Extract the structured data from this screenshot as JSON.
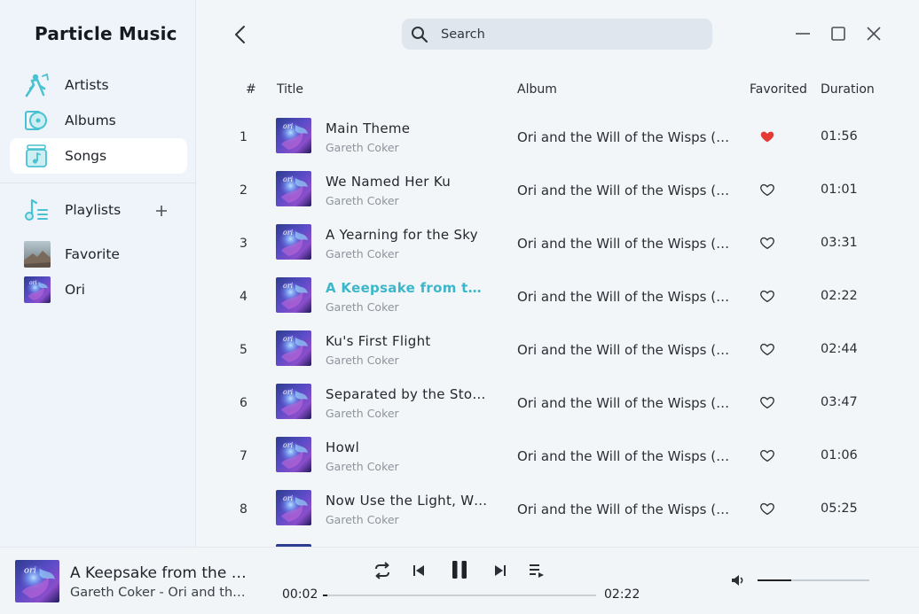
{
  "app": {
    "title": "Particle Music"
  },
  "sidebar": {
    "nav": [
      {
        "label": "Artists",
        "icon": "artist-icon"
      },
      {
        "label": "Albums",
        "icon": "album-icon"
      },
      {
        "label": "Songs",
        "icon": "songs-icon",
        "active": true
      }
    ],
    "playlists_label": "Playlists",
    "playlists": [
      {
        "label": "Favorite"
      },
      {
        "label": "Ori"
      }
    ]
  },
  "search": {
    "placeholder": "Search"
  },
  "table": {
    "headers": {
      "num": "#",
      "title": "Title",
      "album": "Album",
      "favorited": "Favorited",
      "duration": "Duration"
    },
    "rows": [
      {
        "num": "1",
        "title": "Main Theme",
        "artist": "Gareth Coker",
        "album": "Ori and the Will of the Wisps (Original Soundtrack)",
        "favorited": true,
        "duration": "01:56"
      },
      {
        "num": "2",
        "title": "We Named Her Ku",
        "artist": "Gareth Coker",
        "album": "Ori and the Will of the Wisps (Original Soundtrack)",
        "favorited": false,
        "duration": "01:01"
      },
      {
        "num": "3",
        "title": "A Yearning for the Sky",
        "artist": "Gareth Coker",
        "album": "Ori and the Will of the Wisps (Original Soundtrack)",
        "favorited": false,
        "duration": "03:31"
      },
      {
        "num": "4",
        "title": "A Keepsake from the Past",
        "artist": "Gareth Coker",
        "album": "Ori and the Will of the Wisps (Original Soundtrack)",
        "favorited": false,
        "duration": "02:22",
        "playing": true
      },
      {
        "num": "5",
        "title": "Ku's First Flight",
        "artist": "Gareth Coker",
        "album": "Ori and the Will of the Wisps (Original Soundtrack)",
        "favorited": false,
        "duration": "02:44"
      },
      {
        "num": "6",
        "title": "Separated by the Storm",
        "artist": "Gareth Coker",
        "album": "Ori and the Will of the Wisps (Original Soundtrack)",
        "favorited": false,
        "duration": "03:47"
      },
      {
        "num": "7",
        "title": "Howl",
        "artist": "Gareth Coker",
        "album": "Ori and the Will of the Wisps (Original Soundtrack)",
        "favorited": false,
        "duration": "01:06"
      },
      {
        "num": "8",
        "title": "Now Use the Light, Wisp",
        "artist": "Gareth Coker",
        "album": "Ori and the Will of the Wisps (Original Soundtrack)",
        "favorited": false,
        "duration": "05:25"
      }
    ]
  },
  "player": {
    "title": "A Keepsake from the Past",
    "subtitle": "Gareth Coker - Ori and the Will of the Wisps (Original Soundtrack)",
    "elapsed": "00:02",
    "total": "02:22",
    "progress": 0.015,
    "volume": 0.3
  },
  "colors": {
    "accent": "#3ab8c9",
    "favorite": "#e53935",
    "active_nav_bg": "#ffffff"
  }
}
